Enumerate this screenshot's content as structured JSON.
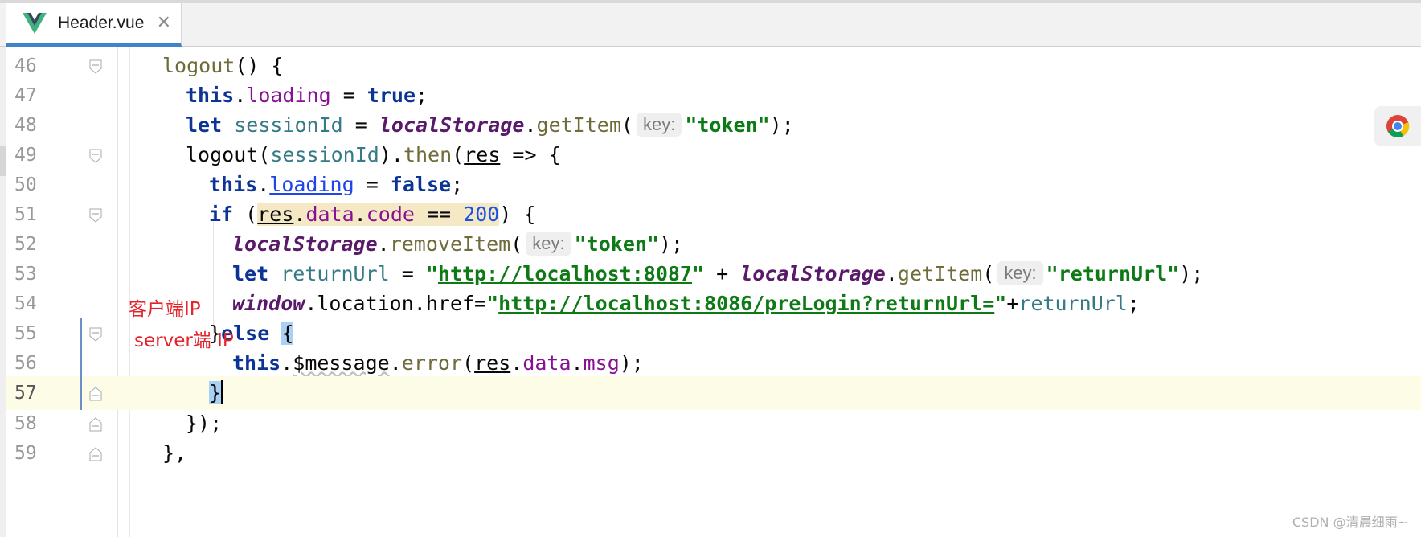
{
  "tab": {
    "file_name": "Header.vue",
    "close_glyph": "✕",
    "icon": "vue-logo-icon"
  },
  "annotations": {
    "client_ip": "客户端IP",
    "server_ip": "server端 IP"
  },
  "hints": {
    "key": "key:"
  },
  "watermark": "CSDN @清晨细雨~",
  "colors": {
    "keyword": "#0c3496",
    "string": "#0e7a15",
    "property": "#871094",
    "current_line": "#fdfce6",
    "annotation": "#e3242b",
    "tab_underline": "#4083c9"
  },
  "lines": [
    {
      "number": "46",
      "tokens": {
        "t1": "logout",
        "t2": "() {"
      }
    },
    {
      "number": "47",
      "tokens": {
        "t1": "this",
        "t2": ".",
        "t3": "loading",
        "t4": " = ",
        "t5": "true",
        "t6": ";"
      }
    },
    {
      "number": "48",
      "tokens": {
        "t1": "let",
        "t2": " ",
        "t3": "sessionId",
        "t4": " = ",
        "t5": "localStorage",
        "t6": ".",
        "t7": "getItem",
        "t8": "(",
        "t9": "\"token\"",
        "t10": ");"
      }
    },
    {
      "number": "49",
      "tokens": {
        "t1": "logout(",
        "t2": "sessionId",
        "t3": ").",
        "t4": "then",
        "t5": "(",
        "t6": "res",
        "t7": " => {"
      }
    },
    {
      "number": "50",
      "tokens": {
        "t1": "this",
        "t2": ".",
        "t3": "loading",
        "t4": " = ",
        "t5": "false",
        "t6": ";"
      }
    },
    {
      "number": "51",
      "tokens": {
        "t1": "if",
        "t2": " (",
        "t3": "res",
        "t4": ".",
        "t5": "data",
        "t6": ".",
        "t7": "code",
        "t8": " == ",
        "t9": "200",
        "t10": ") {"
      }
    },
    {
      "number": "52",
      "tokens": {
        "t1": "localStorage",
        "t2": ".",
        "t3": "removeItem",
        "t4": "(",
        "t5": "\"token\"",
        "t6": ");"
      }
    },
    {
      "number": "53",
      "tokens": {
        "t1": "let",
        "t2": " ",
        "t3": "returnUrl",
        "t4": " = ",
        "t5": "\"",
        "t6": "http://localhost:8087",
        "t7": "\"",
        "t8": " + ",
        "t9": "localStorage",
        "t10": ".",
        "t11": "getItem",
        "t12": "(",
        "t13": "\"returnUrl\"",
        "t14": ");"
      }
    },
    {
      "number": "54",
      "tokens": {
        "t1": "window",
        "t2": ".location.href=",
        "t3": "\"",
        "t4": "http://localhost:8086/preLogin?returnUrl=",
        "t5": "\"",
        "t6": "+",
        "t7": "returnUrl",
        "t8": ";"
      }
    },
    {
      "number": "55",
      "tokens": {
        "t1": "}",
        "t2": "else",
        "t3": " ",
        "t4": "{"
      }
    },
    {
      "number": "56",
      "tokens": {
        "t1": "this",
        "t2": ".",
        "t3": "$message",
        "t4": ".",
        "t5": "error",
        "t6": "(",
        "t7": "res",
        "t8": ".",
        "t9": "data",
        "t10": ".",
        "t11": "msg",
        "t12": ");"
      }
    },
    {
      "number": "57",
      "tokens": {
        "t1": "}"
      }
    },
    {
      "number": "58",
      "tokens": {
        "t1": "});"
      }
    },
    {
      "number": "59",
      "tokens": {
        "t1": "},"
      }
    }
  ]
}
